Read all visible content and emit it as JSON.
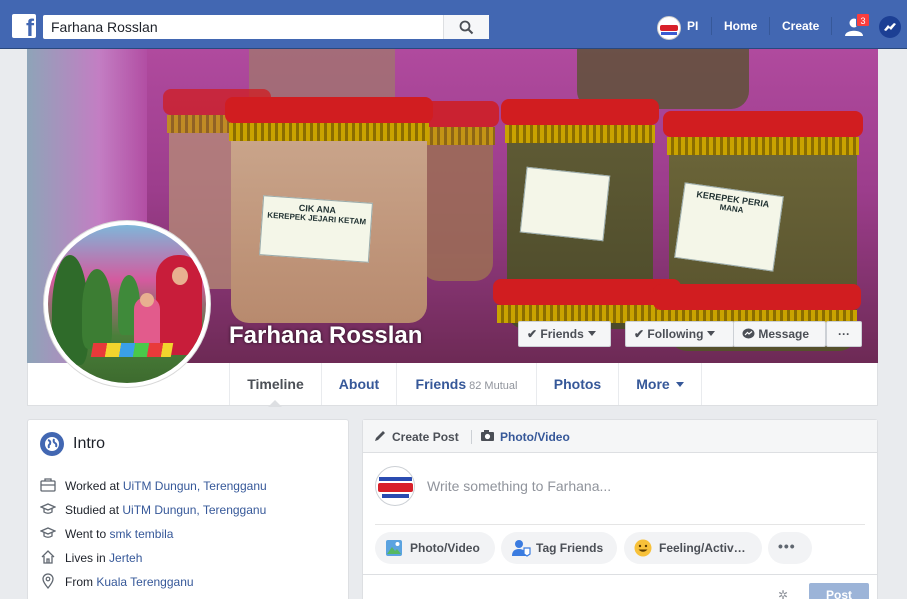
{
  "topbar": {
    "logo_icon": "facebook-logo-icon",
    "search_value": "Farhana Rosslan",
    "search_icon": "search-icon",
    "user_short": "PI",
    "home_label": "Home",
    "create_label": "Create",
    "friend_requests_icon": "friend-requests-icon",
    "friend_requests_count": "3",
    "messenger_icon": "messenger-icon",
    "bar_color": "#4267b2"
  },
  "cover": {
    "name": "Farhana Rosslan",
    "label_left_1": "CIK ANA",
    "label_left_2": "KEREPEK JEJARI KETAM",
    "label_right_1": "KEREPEK PERIA",
    "label_right_2": "MANA"
  },
  "actions": {
    "friends_label": "Friends",
    "following_label": "Following",
    "message_label": "Message",
    "more_label": "···"
  },
  "profile_tabs": [
    {
      "label": "Timeline",
      "active": true
    },
    {
      "label": "About"
    },
    {
      "label": "Friends",
      "meta": "82 Mutual"
    },
    {
      "label": "Photos"
    },
    {
      "label": "More"
    }
  ],
  "intro": {
    "title": "Intro",
    "items": [
      {
        "icon": "briefcase-icon",
        "prefix": "Worked at ",
        "link": "UiTM Dungun, Terengganu"
      },
      {
        "icon": "graduation-cap-icon",
        "prefix": "Studied at ",
        "link": "UiTM Dungun, Terengganu"
      },
      {
        "icon": "graduation-cap-icon",
        "prefix": "Went to ",
        "link": "smk tembila"
      },
      {
        "icon": "home-icon",
        "prefix": "Lives in ",
        "link": "Jerteh"
      },
      {
        "icon": "location-pin-icon",
        "prefix": "From ",
        "link": "Kuala Terengganu"
      }
    ]
  },
  "composer": {
    "create_post_label": "Create Post",
    "photo_video_label": "Photo/Video",
    "placeholder": "Write something to Farhana...",
    "pills": [
      {
        "label": "Photo/Video",
        "icon": "photo-icon"
      },
      {
        "label": "Tag Friends",
        "icon": "tag-friends-icon"
      },
      {
        "label": "Feeling/Activ…",
        "icon": "emoji-icon"
      }
    ],
    "more_dots": "•••",
    "post_label": "Post",
    "settings_icon": "gear-icon"
  }
}
